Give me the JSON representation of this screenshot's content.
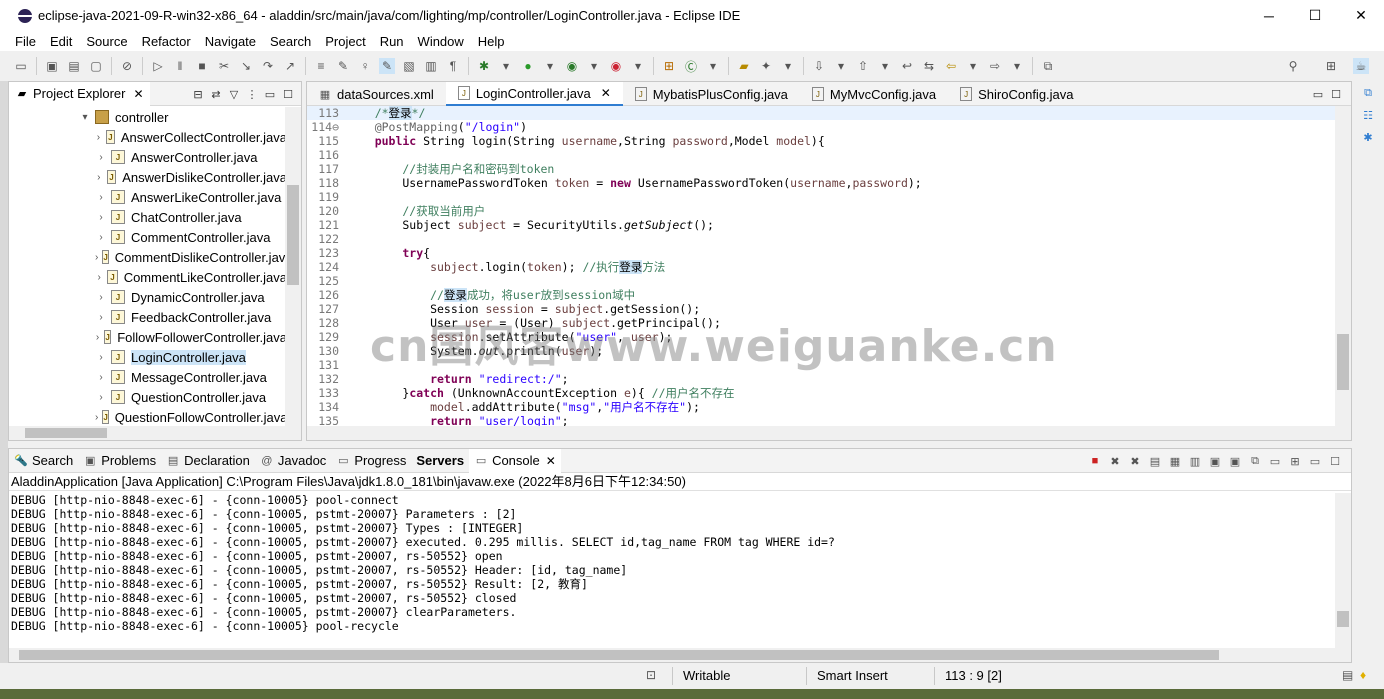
{
  "window": {
    "title": "eclipse-java-2021-09-R-win32-x86_64 - aladdin/src/main/java/com/lighting/mp/controller/LoginController.java - Eclipse IDE",
    "minimize": "─",
    "maximize": "☐",
    "close": "✕"
  },
  "menu": [
    "File",
    "Edit",
    "Source",
    "Refactor",
    "Navigate",
    "Search",
    "Project",
    "Run",
    "Window",
    "Help"
  ],
  "explorer": {
    "tab_label": "Project Explorer",
    "close": "✕",
    "package": "controller",
    "items": [
      "AnswerCollectController.java",
      "AnswerController.java",
      "AnswerDislikeController.java",
      "AnswerLikeController.java",
      "ChatController.java",
      "CommentController.java",
      "CommentDislikeController.java",
      "CommentLikeController.java",
      "DynamicController.java",
      "FeedbackController.java",
      "FollowFollowerController.java",
      "LoginController.java",
      "MessageController.java",
      "QuestionController.java",
      "QuestionFollowController.java"
    ],
    "selected_index": 11
  },
  "editor": {
    "tabs": [
      "dataSources.xml",
      "LoginController.java",
      "MybatisPlusConfig.java",
      "MyMvcConfig.java",
      "ShiroConfig.java"
    ],
    "active_tab": 1,
    "close": "✕",
    "lines": [
      {
        "n": "113",
        "segs": [
          [
            "cm",
            "    /*"
          ],
          [
            "hl",
            "登录"
          ],
          [
            "cm",
            "*/"
          ]
        ],
        "marker": true,
        "current": true
      },
      {
        "n": "114⊖",
        "segs": [
          [
            "an",
            "    @PostMapping"
          ],
          [
            "",
            "("
          ],
          [
            "st",
            "\"/login\""
          ],
          [
            "",
            ")"
          ]
        ]
      },
      {
        "n": "115",
        "segs": [
          [
            "kw",
            "    public"
          ],
          [
            "",
            " String login(String "
          ],
          [
            "vr",
            "username"
          ],
          [
            "",
            ",String "
          ],
          [
            "vr",
            "password"
          ],
          [
            "",
            ",Model "
          ],
          [
            "vr",
            "model"
          ],
          [
            "",
            "){"
          ]
        ]
      },
      {
        "n": "116",
        "segs": [
          [
            "",
            ""
          ]
        ]
      },
      {
        "n": "117",
        "segs": [
          [
            "cm",
            "        //封装用户名和密码到token"
          ]
        ]
      },
      {
        "n": "118",
        "segs": [
          [
            "",
            "        UsernamePasswordToken "
          ],
          [
            "vr",
            "token"
          ],
          [
            "",
            " = "
          ],
          [
            "kw",
            "new"
          ],
          [
            "",
            " UsernamePasswordToken("
          ],
          [
            "vr",
            "username"
          ],
          [
            "",
            ","
          ],
          [
            "vr",
            "password"
          ],
          [
            "",
            ");"
          ]
        ]
      },
      {
        "n": "119",
        "segs": [
          [
            "",
            ""
          ]
        ]
      },
      {
        "n": "120",
        "segs": [
          [
            "cm",
            "        //获取当前用户"
          ]
        ]
      },
      {
        "n": "121",
        "segs": [
          [
            "",
            "        Subject "
          ],
          [
            "vr",
            "subject"
          ],
          [
            "",
            " = SecurityUtils."
          ],
          [
            "it",
            "getSubject"
          ],
          [
            "",
            "();"
          ]
        ]
      },
      {
        "n": "122",
        "segs": [
          [
            "",
            ""
          ]
        ]
      },
      {
        "n": "123",
        "segs": [
          [
            "kw",
            "        try"
          ],
          [
            "",
            "{"
          ]
        ]
      },
      {
        "n": "124",
        "segs": [
          [
            "vr",
            "            subject"
          ],
          [
            "",
            ".login("
          ],
          [
            "vr",
            "token"
          ],
          [
            "",
            "); "
          ],
          [
            "cm",
            "//执行"
          ],
          [
            "hl",
            "登录"
          ],
          [
            "cm",
            "方法"
          ]
        ],
        "marker": true
      },
      {
        "n": "125",
        "segs": [
          [
            "",
            ""
          ]
        ],
        "marker": true
      },
      {
        "n": "126",
        "segs": [
          [
            "cm",
            "            //"
          ],
          [
            "hl",
            "登录"
          ],
          [
            "cm",
            "成功，将user放到session域中"
          ]
        ]
      },
      {
        "n": "127",
        "segs": [
          [
            "",
            "            Session "
          ],
          [
            "vr",
            "session"
          ],
          [
            "",
            " = "
          ],
          [
            "vr",
            "subject"
          ],
          [
            "",
            ".getSession();"
          ]
        ]
      },
      {
        "n": "128",
        "segs": [
          [
            "",
            "            User "
          ],
          [
            "vr",
            "user"
          ],
          [
            "",
            " = (User) "
          ],
          [
            "vr",
            "subject"
          ],
          [
            "",
            ".getPrincipal();"
          ]
        ]
      },
      {
        "n": "129",
        "segs": [
          [
            "vr",
            "            session"
          ],
          [
            "",
            ".setAttribute("
          ],
          [
            "st",
            "\"user\""
          ],
          [
            "",
            ", "
          ],
          [
            "vr",
            "user"
          ],
          [
            "",
            ");"
          ]
        ]
      },
      {
        "n": "130",
        "segs": [
          [
            "",
            "            System."
          ],
          [
            "it",
            "out"
          ],
          [
            "",
            ".println("
          ],
          [
            "vr",
            "user"
          ],
          [
            "",
            ");"
          ]
        ]
      },
      {
        "n": "131",
        "segs": [
          [
            "",
            ""
          ]
        ]
      },
      {
        "n": "132",
        "segs": [
          [
            "kw",
            "            return"
          ],
          [
            "",
            " "
          ],
          [
            "st",
            "\"redirect:/\""
          ],
          [
            "",
            ";"
          ]
        ]
      },
      {
        "n": "133",
        "segs": [
          [
            "",
            "        }"
          ],
          [
            "kw",
            "catch"
          ],
          [
            "",
            " (UnknownAccountException "
          ],
          [
            "vr",
            "e"
          ],
          [
            "",
            "){ "
          ],
          [
            "cm",
            "//用户名不存在"
          ]
        ]
      },
      {
        "n": "134",
        "segs": [
          [
            "vr",
            "            model"
          ],
          [
            "",
            ".addAttribute("
          ],
          [
            "st",
            "\"msg\""
          ],
          [
            "",
            ","
          ],
          [
            "st",
            "\"用户名不存在\""
          ],
          [
            "",
            ");"
          ]
        ]
      },
      {
        "n": "135",
        "segs": [
          [
            "kw",
            "            return"
          ],
          [
            "",
            " "
          ],
          [
            "st",
            "\"user/login\""
          ],
          [
            "",
            ";"
          ]
        ]
      }
    ]
  },
  "bottom": {
    "tabs": [
      {
        "label": "Search",
        "icon": "🔦"
      },
      {
        "label": "Problems",
        "icon": "▣"
      },
      {
        "label": "Declaration",
        "icon": "▤"
      },
      {
        "label": "Javadoc",
        "icon": "@"
      },
      {
        "label": "Progress",
        "icon": "▭"
      },
      {
        "label": "Servers",
        "icon": "",
        "bold": true
      },
      {
        "label": "Console",
        "icon": "▭",
        "active": true,
        "closable": true
      }
    ],
    "console_title": "AladdinApplication [Java Application] C:\\Program Files\\Java\\jdk1.8.0_181\\bin\\javaw.exe  (2022年8月6日下午12:34:50)",
    "console_lines": [
      "DEBUG [http-nio-8848-exec-6] - {conn-10005} pool-connect",
      "DEBUG [http-nio-8848-exec-6] - {conn-10005, pstmt-20007} Parameters : [2]",
      "DEBUG [http-nio-8848-exec-6] - {conn-10005, pstmt-20007} Types : [INTEGER]",
      "DEBUG [http-nio-8848-exec-6] - {conn-10005, pstmt-20007} executed. 0.295 millis. SELECT id,tag_name FROM tag WHERE id=?",
      "DEBUG [http-nio-8848-exec-6] - {conn-10005, pstmt-20007, rs-50552} open",
      "DEBUG [http-nio-8848-exec-6] - {conn-10005, pstmt-20007, rs-50552} Header: [id, tag_name]",
      "DEBUG [http-nio-8848-exec-6] - {conn-10005, pstmt-20007, rs-50552} Result: [2, 教育]",
      "DEBUG [http-nio-8848-exec-6] - {conn-10005, pstmt-20007, rs-50552} closed",
      "DEBUG [http-nio-8848-exec-6] - {conn-10005, pstmt-20007} clearParameters.",
      "DEBUG [http-nio-8848-exec-6] - {conn-10005} pool-recycle"
    ]
  },
  "status": {
    "writable": "Writable",
    "insert_mode": "Smart Insert",
    "position": "113 : 9 [2]"
  },
  "watermark": "cn国风客www.weiguanke.cn",
  "colors": {
    "keyword": "#7f0055",
    "comment": "#3f7f5f",
    "string": "#2a00ff",
    "selection": "#cce4f7",
    "active_tab_accent": "#2f7dd1"
  }
}
